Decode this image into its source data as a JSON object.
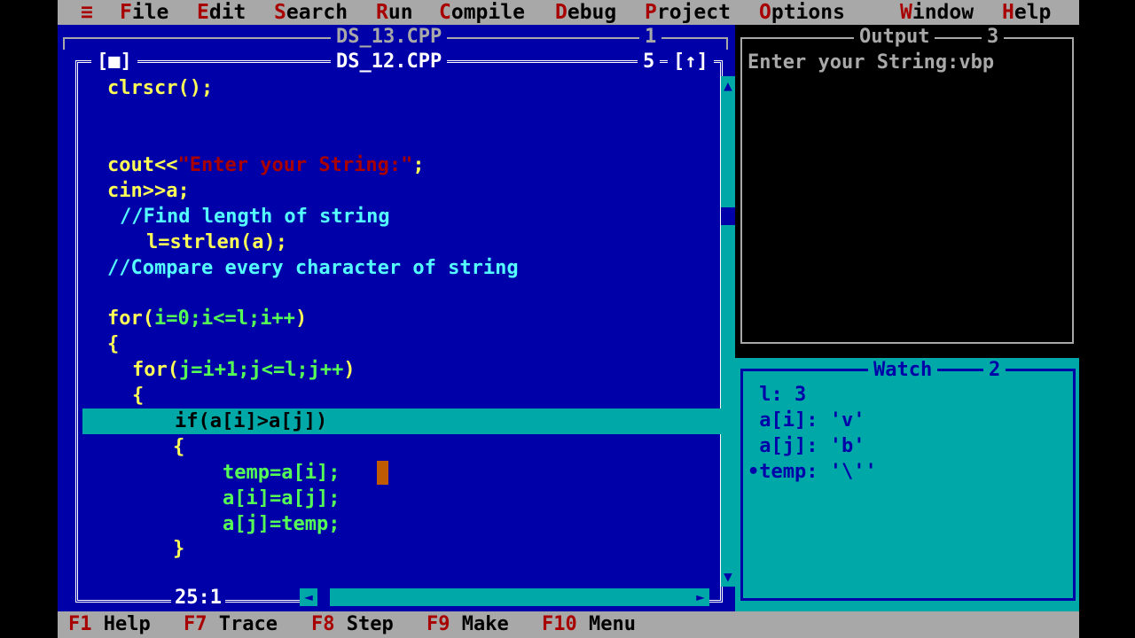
{
  "menu": {
    "system": "≡",
    "items": [
      {
        "hotkey": "F",
        "rest": "ile"
      },
      {
        "hotkey": "E",
        "rest": "dit"
      },
      {
        "hotkey": "S",
        "rest": "earch"
      },
      {
        "hotkey": "R",
        "rest": "un"
      },
      {
        "hotkey": "C",
        "rest": "ompile"
      },
      {
        "hotkey": "D",
        "rest": "ebug"
      },
      {
        "hotkey": "P",
        "rest": "roject"
      },
      {
        "hotkey": "O",
        "rest": "ptions"
      },
      {
        "hotkey": "W",
        "rest": "indow"
      },
      {
        "hotkey": "H",
        "rest": "elp"
      }
    ]
  },
  "back_window": {
    "title": "DS_13.CPP",
    "number": "1"
  },
  "editor": {
    "title": "DS_12.CPP",
    "number": "5",
    "close_box": "[■]",
    "zoom_box": "[↑]",
    "cursor_position": "25:1",
    "lines": {
      "l1": "clrscr();",
      "l4a": "cout<<",
      "l4b": "\"Enter your String:\"",
      "l4c": ";",
      "l5": "cin>>a;",
      "l6": "//Find length of string",
      "l7": "l=strlen(a);",
      "l8": "//Compare every character of string",
      "l10a": "for(",
      "l10b": "i=0;i<=l;i++",
      "l10c": ")",
      "l11": "{",
      "l12a": "for(",
      "l12b": "j=i+1;j<=l;j++",
      "l12c": ")",
      "l13": "{",
      "l14": "if(a[i]>a[j])",
      "l15": "{",
      "l16": "temp=a[i];",
      "l17": "a[i]=a[j];",
      "l18": "a[j]=temp;",
      "l19": "}"
    }
  },
  "output": {
    "title": "Output",
    "number": "3",
    "text": "Enter your String:vbp"
  },
  "watch": {
    "title": "Watch",
    "number": "2",
    "entries": [
      " l: 3",
      " a[i]: 'v'",
      " a[j]: 'b'",
      "•temp: '\\''"
    ]
  },
  "function_keys": [
    {
      "key": "F1",
      "label": "Help"
    },
    {
      "key": "F7",
      "label": "Trace"
    },
    {
      "key": "F8",
      "label": "Step"
    },
    {
      "key": "F9",
      "label": "Make"
    },
    {
      "key": "F10",
      "label": "Menu"
    }
  ],
  "colors": {
    "desktop_blue": "#0000A8",
    "menu_gray": "#A8A8A8",
    "hotkey_red": "#A80000",
    "code_yellow": "#FFFF55",
    "comment_cyan": "#55FFFF",
    "highlight_cyan": "#00A8A8",
    "cursor_orange": "#C05A00"
  }
}
